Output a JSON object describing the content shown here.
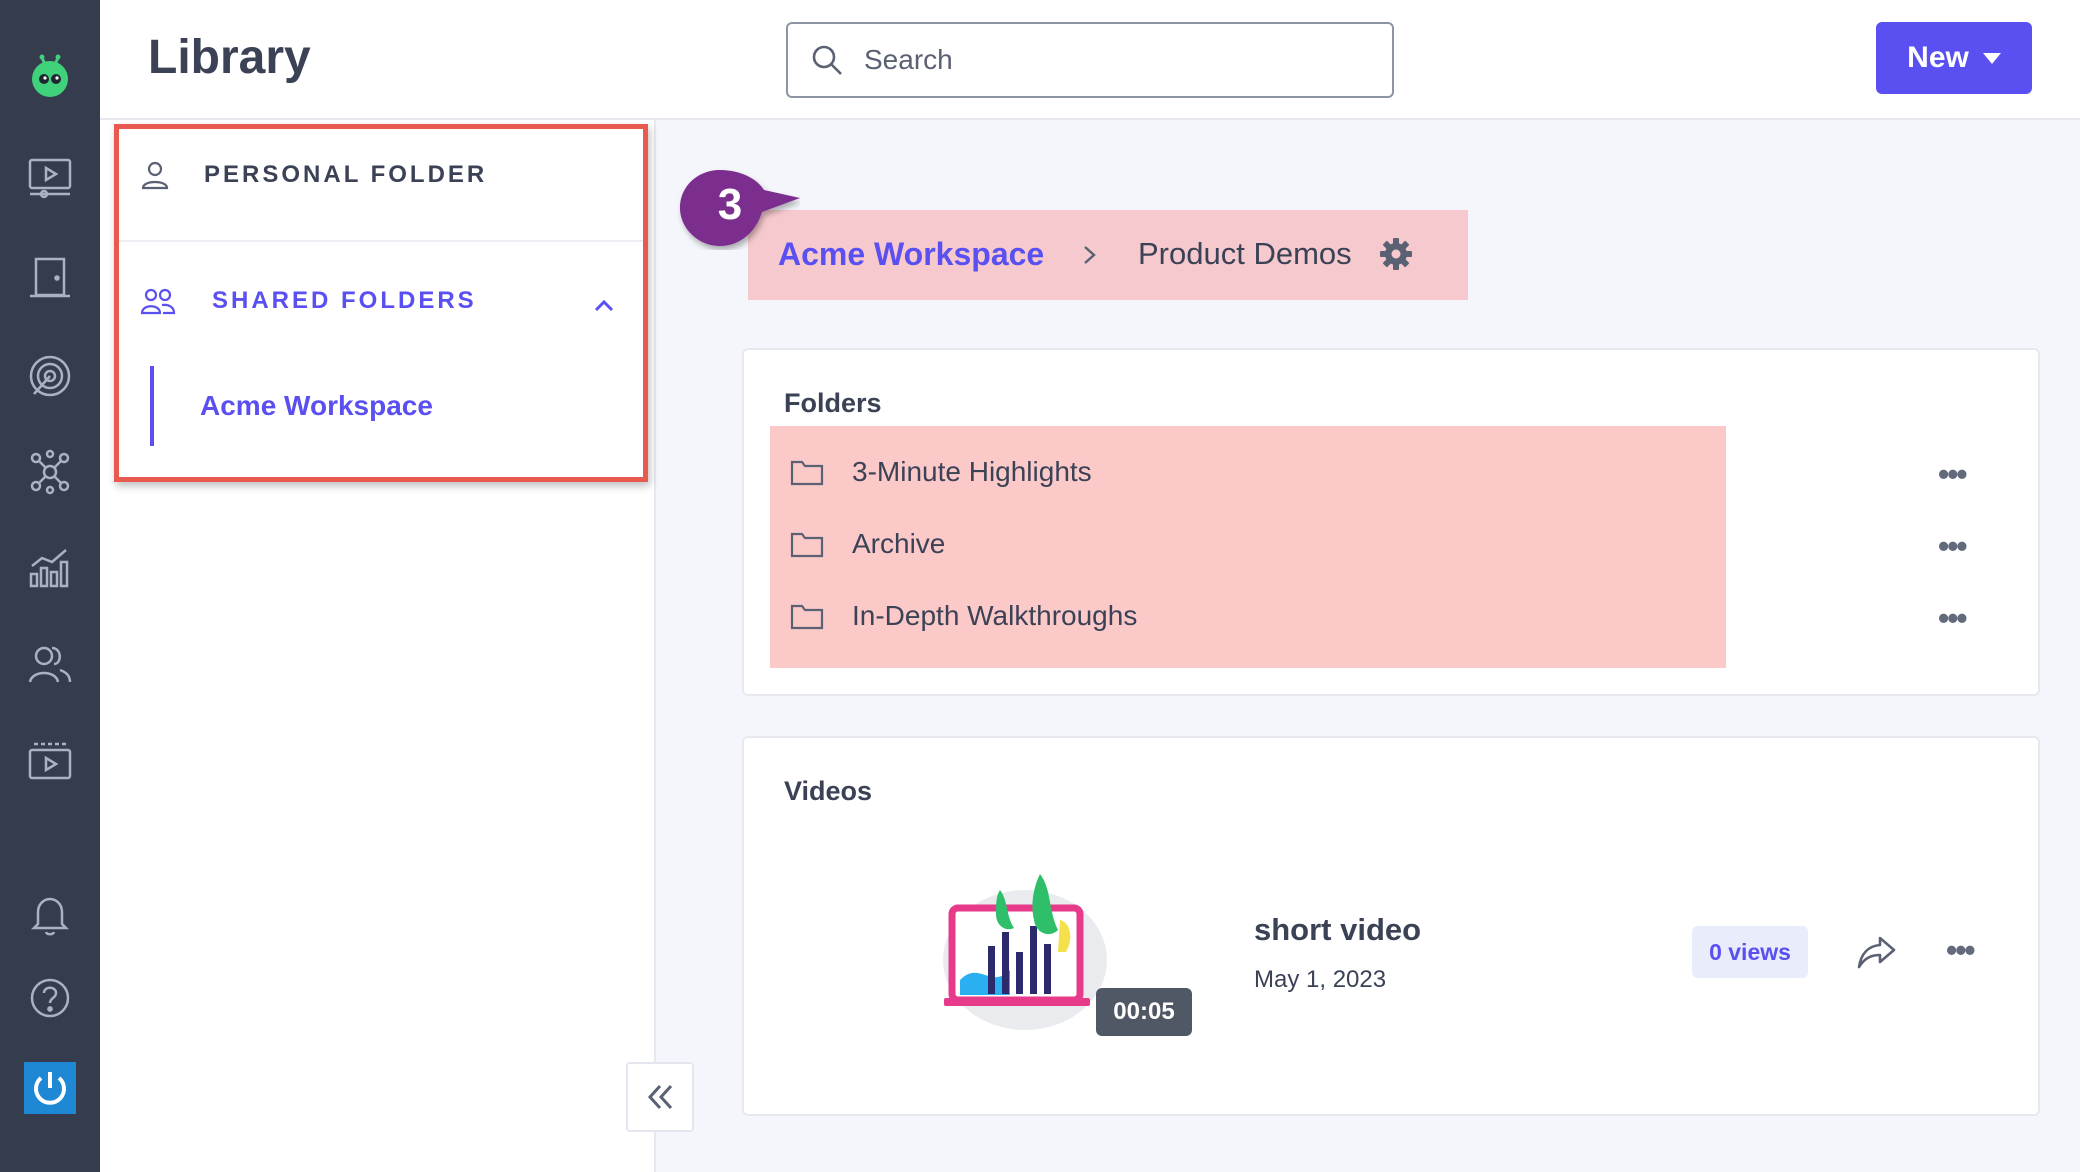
{
  "header": {
    "title": "Library",
    "search_placeholder": "Search",
    "new_label": "New"
  },
  "rail": {
    "icons": [
      "robot-logo-icon",
      "video-player-icon",
      "door-icon",
      "target-icon",
      "network-icon",
      "analytics-icon",
      "users-icon",
      "playlist-icon",
      "bell-icon",
      "help-icon",
      "power-icon"
    ]
  },
  "sidebar": {
    "personal_folder": "PERSONAL FOLDER",
    "shared_folders": "SHARED FOLDERS",
    "workspace": "Acme Workspace"
  },
  "breadcrumb": {
    "step": "3",
    "workspace": "Acme Workspace",
    "current": "Product Demos"
  },
  "folders": {
    "title": "Folders",
    "items": [
      {
        "label": "3-Minute Highlights"
      },
      {
        "label": "Archive"
      },
      {
        "label": "In-Depth Walkthroughs"
      }
    ]
  },
  "videos": {
    "title": "Videos",
    "items": [
      {
        "title": "short video",
        "date": "May 1, 2023",
        "duration": "00:05",
        "views": "0 views"
      }
    ]
  },
  "colors": {
    "accent": "#5a4ff0",
    "rail": "#353c4e",
    "highlight": "#fcc9c9",
    "annotation_border": "#e85a4f",
    "step_badge": "#7b2d8e"
  }
}
